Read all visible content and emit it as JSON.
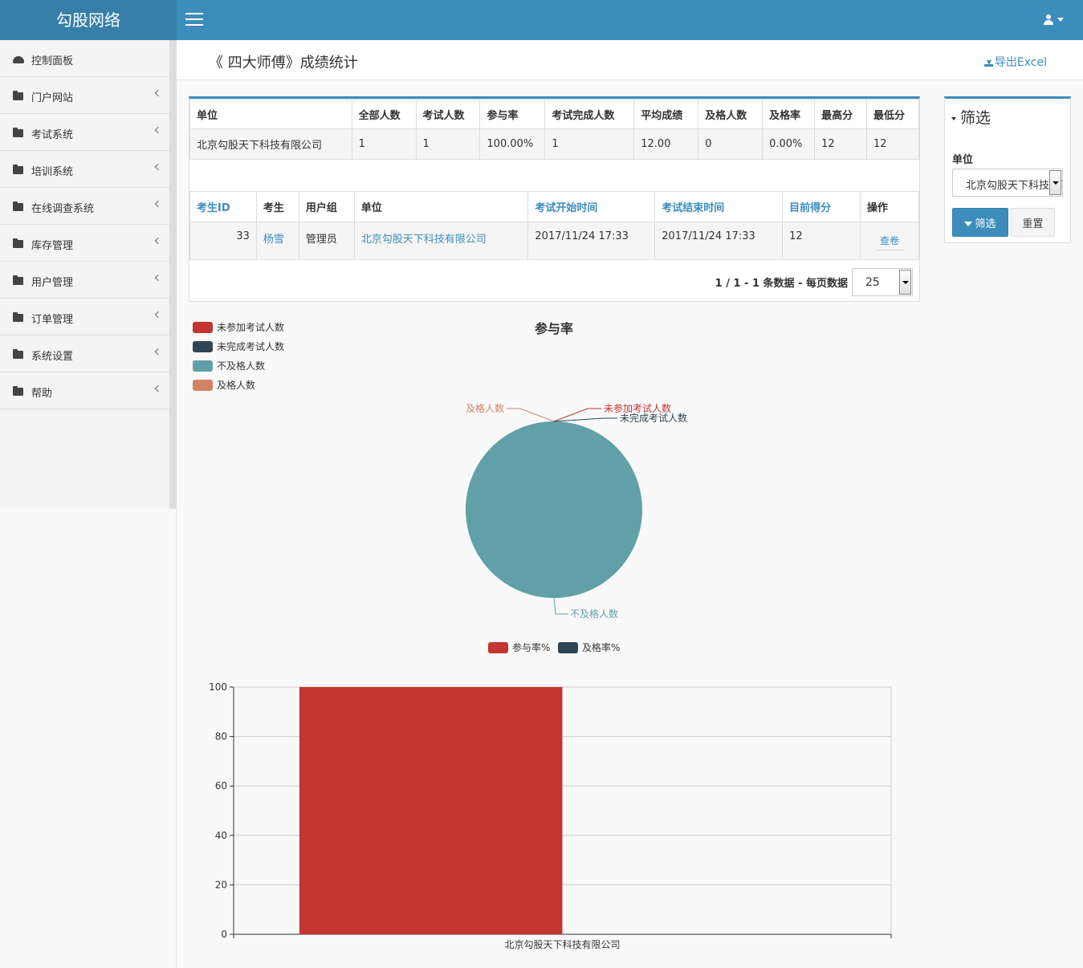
{
  "app": {
    "logo": "勾股网络"
  },
  "sidebar": {
    "items": [
      {
        "label": "控制面板"
      },
      {
        "label": "门户网站"
      },
      {
        "label": "考试系统"
      },
      {
        "label": "培训系统"
      },
      {
        "label": "在线调查系统"
      },
      {
        "label": "库存管理"
      },
      {
        "label": "用户管理"
      },
      {
        "label": "订单管理"
      },
      {
        "label": "系统设置"
      },
      {
        "label": "帮助"
      }
    ]
  },
  "header": {
    "title": "《 四大师傅》成绩统计",
    "export_label": "导出Excel"
  },
  "stats": {
    "headers": [
      "单位",
      "全部人数",
      "考试人数",
      "参与率",
      "考试完成人数",
      "平均成绩",
      "及格人数",
      "及格率",
      "最高分",
      "最低分"
    ],
    "row": [
      "北京勾股天下科技有限公司",
      "1",
      "1",
      "100.00%",
      "1",
      "12.00",
      "0",
      "0.00%",
      "12",
      "12"
    ]
  },
  "exam": {
    "headers": [
      "考生ID",
      "考生",
      "用户组",
      "单位",
      "考试开始时间",
      "考试结束时间",
      "目前得分",
      "操作"
    ],
    "rows": [
      {
        "id": "33",
        "name": "杨雪",
        "group": "管理员",
        "unit": "北京勾股天下科技有限公司",
        "start": "2017/11/24 17:33",
        "end": "2017/11/24 17:33",
        "score": "12",
        "action": "查卷"
      }
    ]
  },
  "pager": {
    "text": "1 / 1 - 1 条数据 - 每页数据",
    "page_size": "25"
  },
  "filter": {
    "title": "筛选",
    "unit_label": "单位",
    "unit_value": "北京勾股天下科技有限公司",
    "submit_label": "筛选",
    "reset_label": "重置"
  },
  "chart_data": [
    {
      "type": "pie",
      "title": "参与率",
      "legend": [
        "未参加考试人数",
        "未完成考试人数",
        "不及格人数",
        "及格人数"
      ],
      "legend_placement": "top-left",
      "values": [
        0,
        0,
        1,
        0
      ],
      "colors": [
        "#c23531",
        "#2f4554",
        "#61a0a8",
        "#d48265"
      ]
    },
    {
      "type": "bar",
      "categories": [
        "北京勾股天下科技有限公司"
      ],
      "series": [
        {
          "name": "参与率%",
          "values": [
            100
          ],
          "color": "#c23531"
        },
        {
          "name": "及格率%",
          "values": [
            0
          ],
          "color": "#2f4554"
        }
      ],
      "ylim": [
        0,
        100
      ],
      "yticks": [
        0,
        20,
        40,
        60,
        80,
        100
      ],
      "grid": true,
      "legend_placement": "top-center"
    }
  ]
}
